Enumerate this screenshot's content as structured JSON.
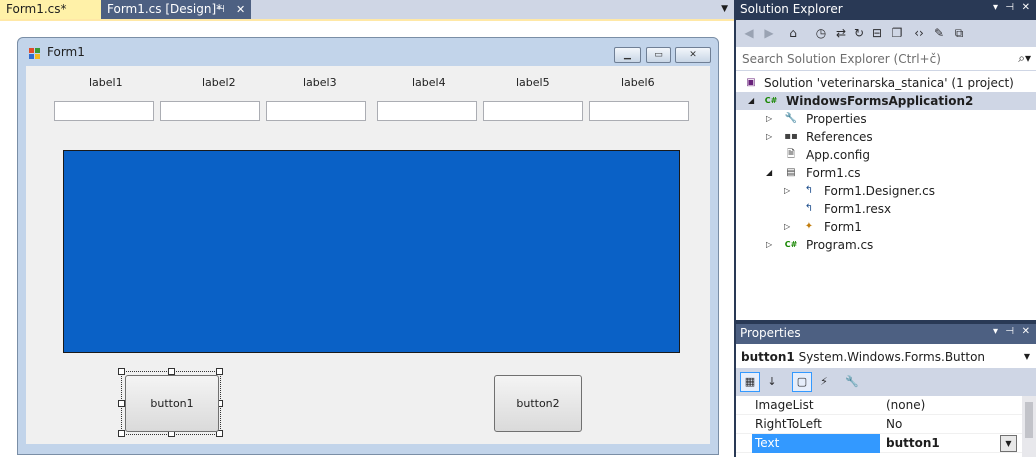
{
  "tabs": [
    {
      "label": "Form1.cs*"
    },
    {
      "label": "Form1.cs [Design]*"
    }
  ],
  "form": {
    "title": "Form1",
    "labels": [
      "label1",
      "label2",
      "label3",
      "label4",
      "label5",
      "label6"
    ],
    "button1": "button1",
    "button2": "button2",
    "colors": {
      "panel": "#0a61c6",
      "form_bg": "#f0f0f0"
    }
  },
  "solution_explorer": {
    "title": "Solution Explorer",
    "search_placeholder": "Search Solution Explorer (Ctrl+č)",
    "tree": [
      {
        "label": "Solution 'veterinarska_stanica' (1 project)",
        "icon": "solution-icon"
      },
      {
        "label": "WindowsFormsApplication2",
        "icon": "csharp-project-icon",
        "bold": true
      },
      {
        "label": "Properties",
        "icon": "wrench-icon"
      },
      {
        "label": "References",
        "icon": "references-icon"
      },
      {
        "label": "App.config",
        "icon": "config-icon"
      },
      {
        "label": "Form1.cs",
        "icon": "form-file-icon"
      },
      {
        "label": "Form1.Designer.cs",
        "icon": "code-file-icon"
      },
      {
        "label": "Form1.resx",
        "icon": "resx-file-icon"
      },
      {
        "label": "Form1",
        "icon": "class-icon"
      },
      {
        "label": "Program.cs",
        "icon": "csharp-file-icon"
      }
    ]
  },
  "properties": {
    "title": "Properties",
    "object_name": "button1",
    "object_type": "System.Windows.Forms.Button",
    "rows": [
      {
        "name": "ImageList",
        "value": "(none)"
      },
      {
        "name": "RightToLeft",
        "value": "No"
      },
      {
        "name": "Text",
        "value": "button1"
      }
    ]
  },
  "theme": {
    "header_dark": "#293955",
    "header": "#4d6082",
    "toolbar": "#cfd6e5",
    "active_tab": "#fff1a8",
    "selection": "#3399ff"
  }
}
